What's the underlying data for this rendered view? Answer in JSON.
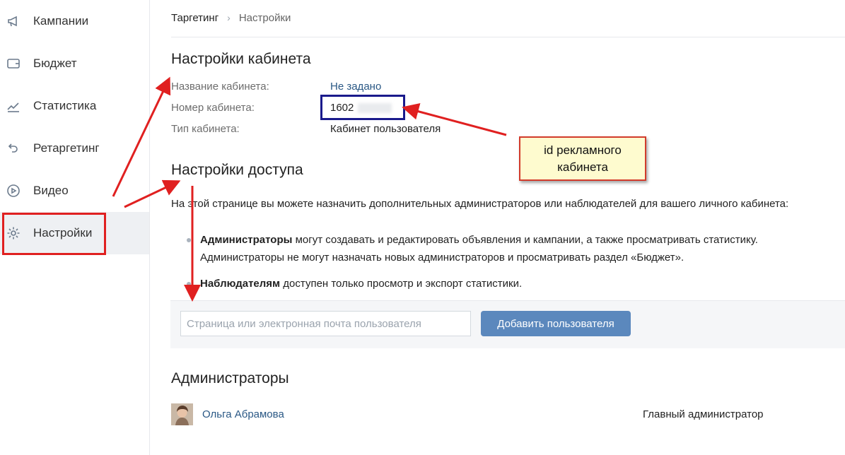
{
  "sidebar": {
    "items": [
      {
        "label": "Кампании",
        "icon": "megaphone-icon"
      },
      {
        "label": "Бюджет",
        "icon": "wallet-icon"
      },
      {
        "label": "Статистика",
        "icon": "chart-line-icon"
      },
      {
        "label": "Ретаргетинг",
        "icon": "return-arrow-icon"
      },
      {
        "label": "Видео",
        "icon": "play-circle-icon"
      },
      {
        "label": "Настройки",
        "icon": "gear-icon",
        "active": true
      }
    ]
  },
  "breadcrumb": {
    "root": "Таргетинг",
    "separator": "›",
    "current": "Настройки"
  },
  "cabinet": {
    "title": "Настройки кабинета",
    "rows": [
      {
        "label": "Название кабинета:",
        "value": "Не задано"
      },
      {
        "label": "Номер кабинета:",
        "value": "1602"
      },
      {
        "label": "Тип кабинета:",
        "value": "Кабинет пользователя"
      }
    ]
  },
  "access": {
    "title": "Настройки доступа",
    "description": "На этой странице вы можете назначить дополнительных администраторов или наблюдателей для вашего личного кабинета:",
    "admins_bold": "Администраторы",
    "admins_rest": " могут создавать и редактировать объявления и кампании, а также просматривать статистику.",
    "admins_line2": "Администраторы не могут назначать новых администраторов и просматривать раздел «Бюджет».",
    "observers_bold": "Наблюдателям",
    "observers_rest": " доступен только просмотр и экспорт статистики.",
    "input_placeholder": "Страница или электронная почта пользователя",
    "input_value": "",
    "add_button": "Добавить пользователя"
  },
  "administrators": {
    "title": "Администраторы",
    "list": [
      {
        "name": "Ольга Абрамова",
        "role": "Главный администратор"
      }
    ]
  },
  "annotation": {
    "note": "id рекламного кабинета"
  },
  "colors": {
    "accent": "#5b88bd",
    "link": "#2a5885",
    "annotation_red": "#e02020",
    "annotation_blue": "#1a1a8c",
    "note_bg": "#fefbcf"
  }
}
